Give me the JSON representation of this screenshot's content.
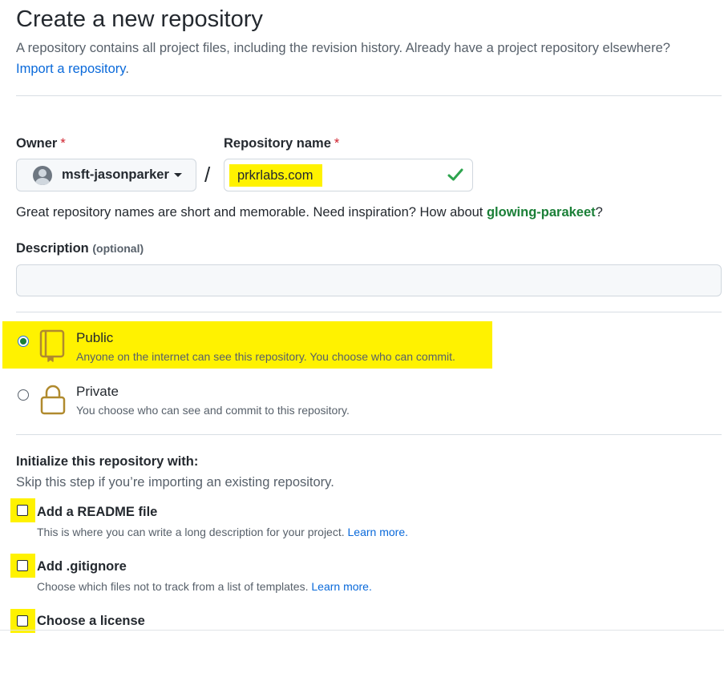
{
  "page": {
    "title": "Create a new repository",
    "subtitle": "A repository contains all project files, including the revision history. Already have a project repository elsewhere?",
    "import_link": "Import a repository",
    "import_suffix": "."
  },
  "owner": {
    "label": "Owner",
    "required_mark": "*",
    "value": "msft-jasonparker"
  },
  "separator": "/",
  "repository": {
    "label": "Repository name",
    "required_mark": "*",
    "value": "prkrlabs.com",
    "help_text": "Great repository names are short and memorable. Need inspiration? How about ",
    "suggestion": "glowing-parakeet",
    "help_suffix": "?"
  },
  "description": {
    "label": "Description",
    "optional_label": "(optional)",
    "value": ""
  },
  "visibility": {
    "selected": "public",
    "options": [
      {
        "id": "public",
        "title": "Public",
        "description": "Anyone on the internet can see this repository. You choose who can commit.",
        "icon": "repo-book-icon"
      },
      {
        "id": "private",
        "title": "Private",
        "description": "You choose who can see and commit to this repository.",
        "icon": "lock-icon"
      }
    ]
  },
  "initialize": {
    "title": "Initialize this repository with:",
    "subtitle": "Skip this step if you’re importing an existing repository.",
    "readme": {
      "title": "Add a README file",
      "description": "This is where you can write a long description for your project.",
      "link": "Learn more.",
      "checked": false
    },
    "gitignore": {
      "title": "Add .gitignore",
      "description": "Choose which files not to track from a list of templates.",
      "link": "Learn more.",
      "checked": false
    },
    "license": {
      "title": "Choose a license",
      "checked": false
    }
  },
  "colors": {
    "highlight": "#fff200",
    "link": "#0969da",
    "success": "#1a7f37",
    "required": "#cf222e",
    "icon_gold": "#b08a2e"
  }
}
